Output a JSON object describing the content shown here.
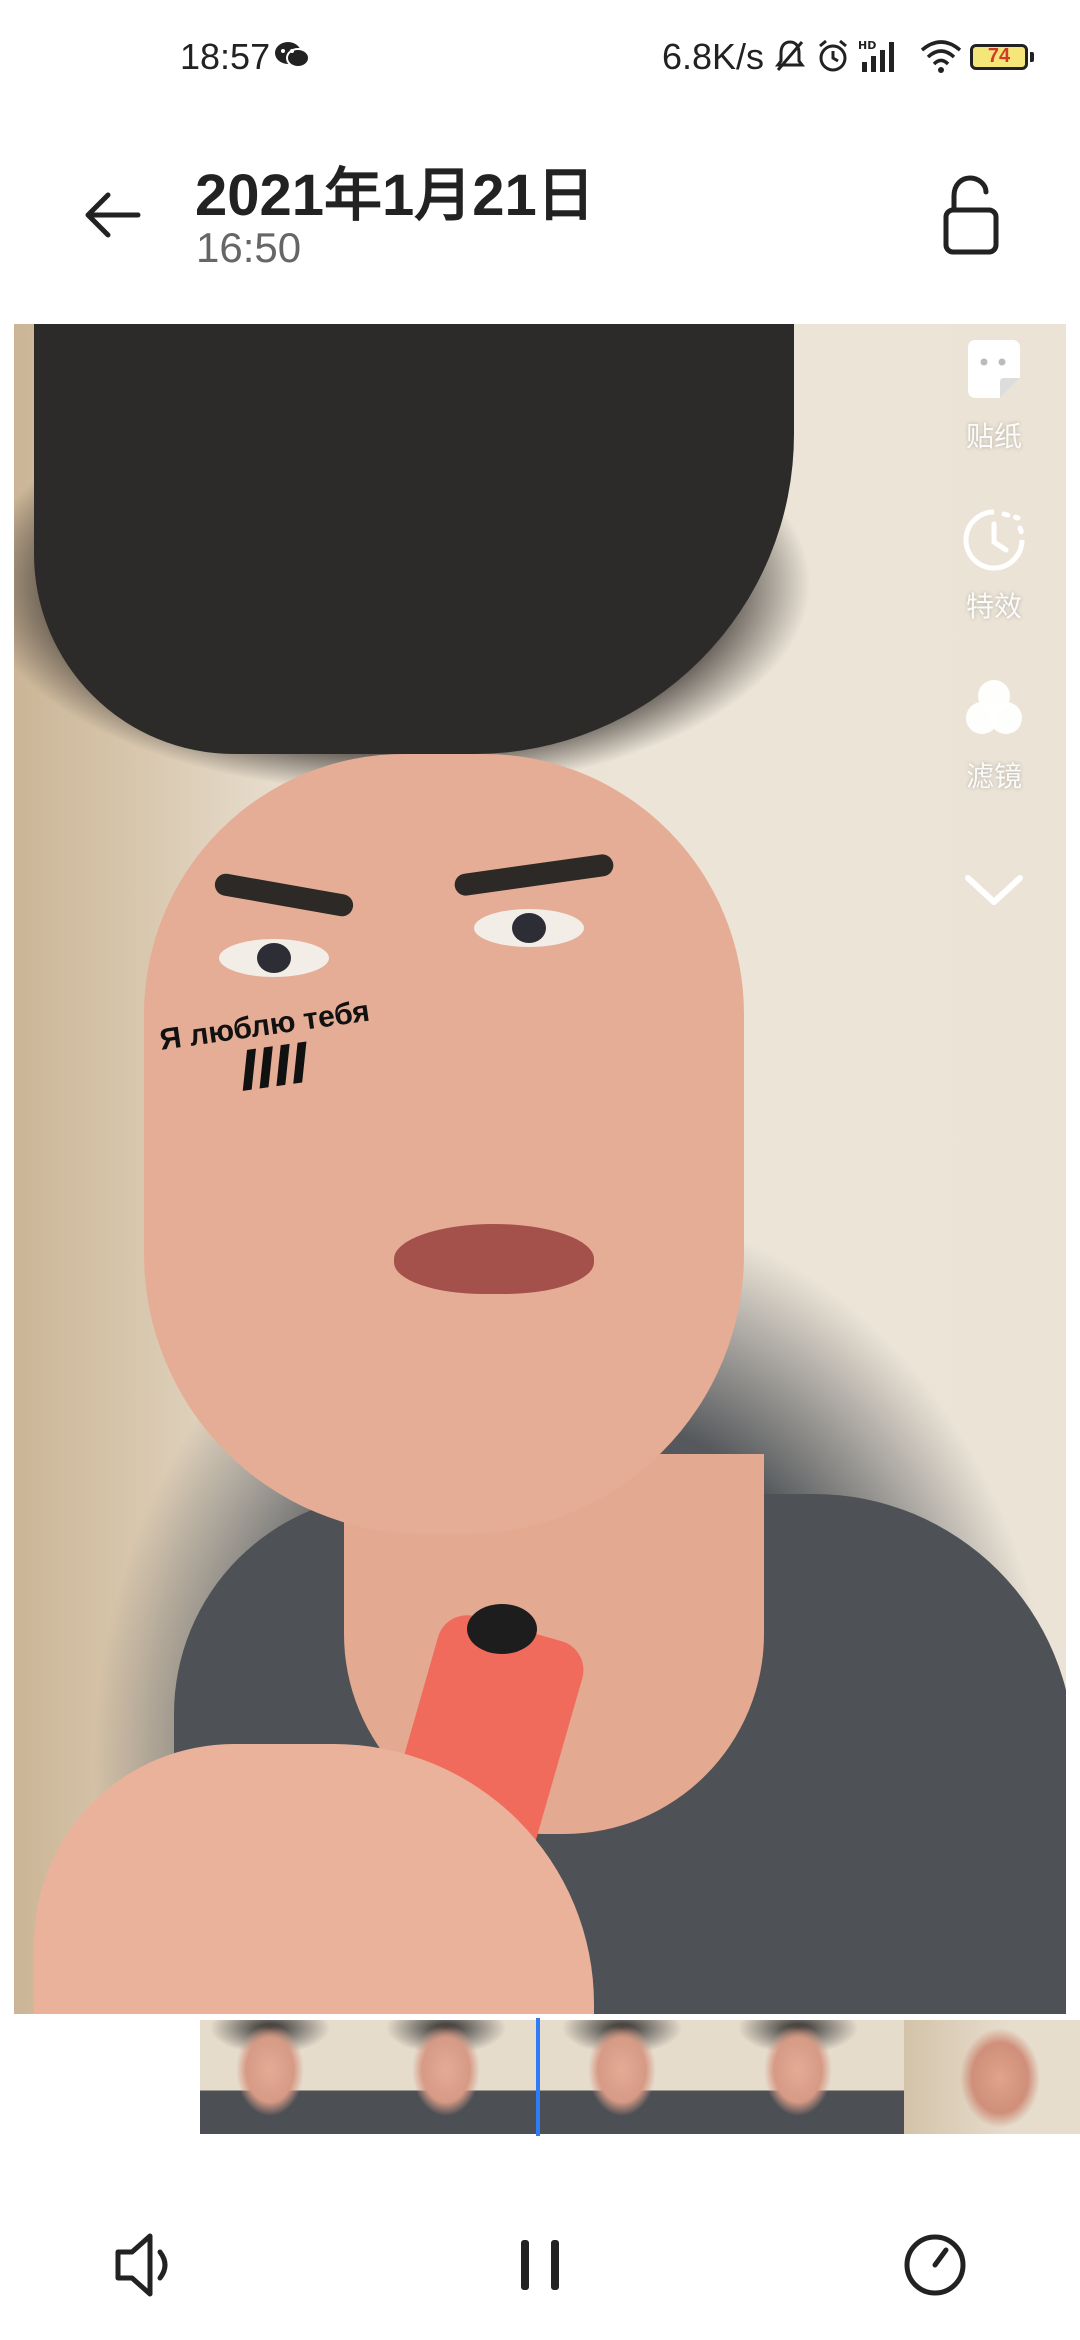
{
  "status_bar": {
    "time": "18:57",
    "net_speed": "6.8K/s",
    "battery": "74",
    "icons": [
      "wechat-icon",
      "mute-icon",
      "alarm-icon",
      "hd-signal-icon",
      "wifi-icon",
      "battery-icon"
    ]
  },
  "header": {
    "date": "2021年1月21日",
    "time": "16:50",
    "back_icon": "back-arrow-icon",
    "lock_icon": "unlock-icon"
  },
  "video": {
    "sticker_text": "Я люблю тебя",
    "side_tools": [
      {
        "icon": "sticker-icon",
        "label": "贴纸"
      },
      {
        "icon": "effects-icon",
        "label": "特效"
      },
      {
        "icon": "filter-icon",
        "label": "滤镜"
      }
    ],
    "collapse_icon": "chevron-down-icon"
  },
  "filmstrip": {
    "frames": 5
  },
  "controls": {
    "icons": [
      "volume-icon",
      "pause-icon",
      "speed-icon"
    ]
  },
  "colors": {
    "playhead": "#2f7df6",
    "battery_fill": "#f5e67a",
    "battery_text": "#d23b2a"
  }
}
